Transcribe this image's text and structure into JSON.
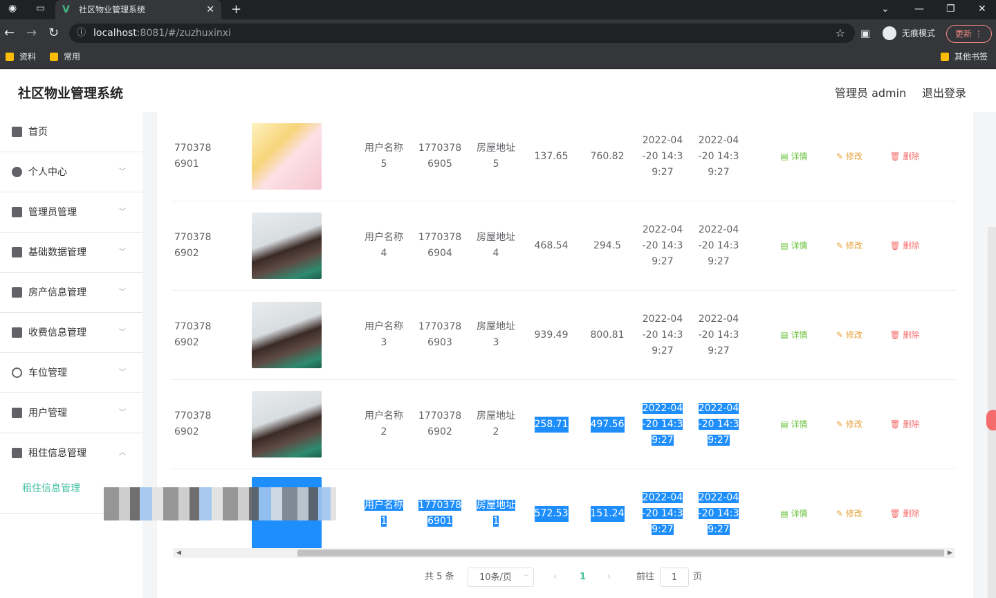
{
  "browser": {
    "tab_title": "社区物业管理系统",
    "tab_close": "✕",
    "new_tab": "+",
    "url_host": "localhost",
    "url_rest": ":8081/#/zuzhuxinxi",
    "incognito_label": "无痕模式",
    "update_label": "更新",
    "bookmarks": [
      "资料",
      "常用"
    ],
    "other_bookmarks": "其他书签"
  },
  "app": {
    "title": "社区物业管理系统",
    "admin_label": "管理员 admin",
    "logout_label": "退出登录"
  },
  "sidebar": {
    "items": [
      {
        "label": "首页",
        "icon": "home-icon"
      },
      {
        "label": "个人中心",
        "icon": "user-icon"
      },
      {
        "label": "管理员管理",
        "icon": "id-card-icon"
      },
      {
        "label": "基础数据管理",
        "icon": "list-icon"
      },
      {
        "label": "房产信息管理",
        "icon": "grid-icon"
      },
      {
        "label": "收费信息管理",
        "icon": "document-icon"
      },
      {
        "label": "车位管理",
        "icon": "clock-icon"
      },
      {
        "label": "用户管理",
        "icon": "stamp-icon"
      },
      {
        "label": "租住信息管理",
        "icon": "monitor-icon"
      }
    ],
    "submenu_label": "租住信息管理"
  },
  "table": {
    "rows": [
      {
        "id_line1": "770378",
        "id_line2": "6901",
        "image": "anime-girl",
        "user_line1": "用户名称",
        "user_line2": "5",
        "phone_line1": "1770378",
        "phone_line2": "6905",
        "addr_line1": "房屋地址",
        "addr_line2": "5",
        "v1": "137.65",
        "v2": "760.82",
        "d1_l1": "2022-04",
        "d1_l2": "-20 14:3",
        "d1_l3": "9:27",
        "d2_l1": "2022-04",
        "d2_l2": "-20 14:3",
        "d2_l3": "9:27",
        "selected": false
      },
      {
        "id_line1": "770378",
        "id_line2": "6902",
        "image": "woman-portrait",
        "user_line1": "用户名称",
        "user_line2": "4",
        "phone_line1": "1770378",
        "phone_line2": "6904",
        "addr_line1": "房屋地址",
        "addr_line2": "4",
        "v1": "468.54",
        "v2": "294.5",
        "d1_l1": "2022-04",
        "d1_l2": "-20 14:3",
        "d1_l3": "9:27",
        "d2_l1": "2022-04",
        "d2_l2": "-20 14:3",
        "d2_l3": "9:27",
        "selected": false
      },
      {
        "id_line1": "770378",
        "id_line2": "6902",
        "image": "woman-portrait",
        "user_line1": "用户名称",
        "user_line2": "3",
        "phone_line1": "1770378",
        "phone_line2": "6903",
        "addr_line1": "房屋地址",
        "addr_line2": "3",
        "v1": "939.49",
        "v2": "800.81",
        "d1_l1": "2022-04",
        "d1_l2": "-20 14:3",
        "d1_l3": "9:27",
        "d2_l1": "2022-04",
        "d2_l2": "-20 14:3",
        "d2_l3": "9:27",
        "selected": false
      },
      {
        "id_line1": "770378",
        "id_line2": "6902",
        "image": "woman-portrait",
        "user_line1": "用户名称",
        "user_line2": "2",
        "phone_line1": "1770378",
        "phone_line2": "6902",
        "addr_line1": "房屋地址",
        "addr_line2": "2",
        "v1": "258.71",
        "v2": "497.56",
        "d1_l1": "2022-04",
        "d1_l2": "-20 14:3",
        "d1_l3": "9:27",
        "d2_l1": "2022-04",
        "d2_l2": "-20 14:3",
        "d2_l3": "9:27",
        "selected": "partial"
      },
      {
        "id_line1": "",
        "id_line2": "",
        "image": "selected-thumb",
        "user_line1": "用户名称",
        "user_line2": "1",
        "phone_line1": "1770378",
        "phone_line2": "6901",
        "addr_line1": "房屋地址",
        "addr_line2": "1",
        "v1": "572.53",
        "v2": "151.24",
        "d1_l1": "2022-04",
        "d1_l2": "-20 14:3",
        "d1_l3": "9:27",
        "d2_l1": "2022-04",
        "d2_l2": "-20 14:3",
        "d2_l3": "9:27",
        "selected": true
      }
    ],
    "ops": {
      "detail": "详情",
      "edit": "修改",
      "delete": "删除"
    }
  },
  "pagination": {
    "total": "共 5 条",
    "page_size": "10条/页",
    "prev": "‹",
    "current_page": "1",
    "next": "›",
    "goto_label": "前往",
    "goto_value": "1",
    "page_suffix": "页"
  },
  "colors": {
    "accent": "#44c0a0",
    "selection": "#1e8efc",
    "detail": "#67c23a",
    "edit": "#e6a23c",
    "delete": "#f56c6c"
  }
}
